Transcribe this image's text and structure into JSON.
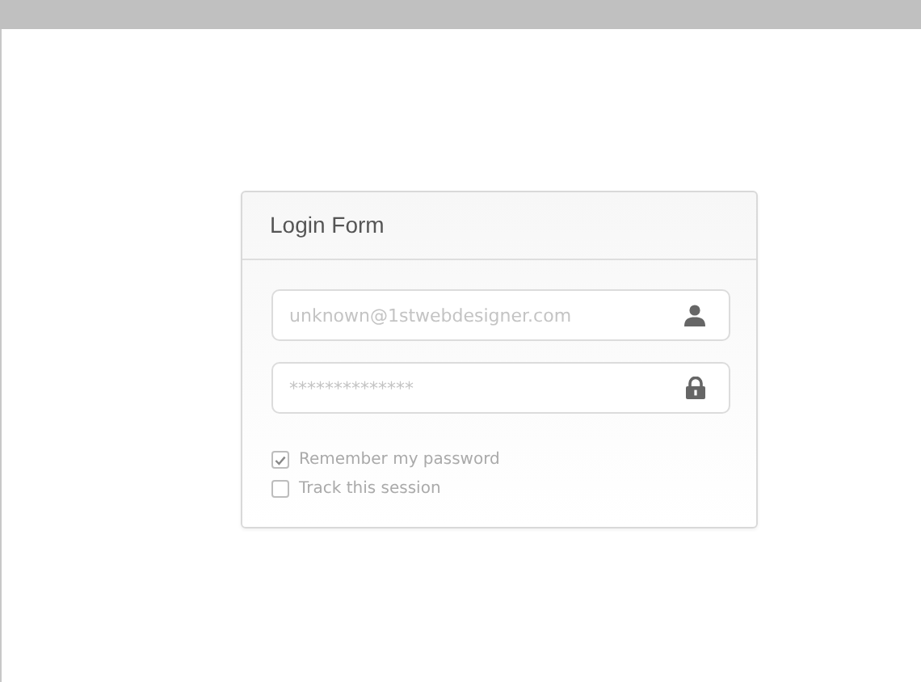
{
  "form": {
    "title": "Login Form",
    "fields": [
      {
        "kind": "user",
        "placeholder": "unknown@1stwebdesigner.com"
      },
      {
        "kind": "lock",
        "placeholder": "**************"
      }
    ],
    "options": [
      {
        "label": "Remember my password",
        "checked": true
      },
      {
        "label": "Track this session",
        "checked": false
      }
    ]
  }
}
